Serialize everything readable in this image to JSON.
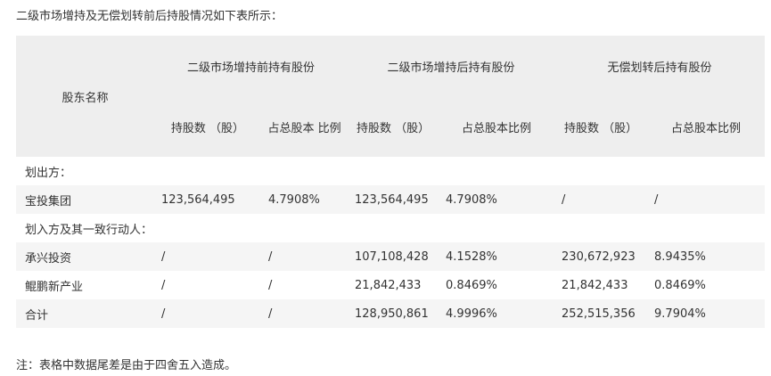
{
  "intro": "二级市场增持及无偿划转前后持股情况如下表所示：",
  "table": {
    "col_name": "股东名称",
    "groups": [
      "二级市场增持前持有股份",
      "二级市场增持后持有股份",
      "无偿划转后持有股份"
    ],
    "subheaders": [
      "持股数 （股）",
      "占总股本 比例",
      "持股数 （股）",
      "占总股本比例",
      "持股数 （股）",
      "占总股本比例"
    ],
    "section_out": "划出方：",
    "row_baotou": [
      "宝投集团",
      "123,564,495",
      "4.7908%",
      "123,564,495",
      "4.7908%",
      "/",
      "/"
    ],
    "section_in": "划入方及其一致行动人：",
    "row_chengxing": [
      "承兴投资",
      "/",
      "/",
      "107,108,428",
      "4.1528%",
      "230,672,923",
      "8.9435%"
    ],
    "row_kunpeng": [
      "鲲鹏新产业",
      "/",
      "/",
      "21,842,433",
      "0.8469%",
      "21,842,433",
      "0.8469%"
    ],
    "row_total": [
      "合计",
      "/",
      "/",
      "128,950,861",
      "4.9996%",
      "252,515,356",
      "9.7904%"
    ]
  },
  "note": "注：表格中数据尾差是由于四舍五入造成。"
}
